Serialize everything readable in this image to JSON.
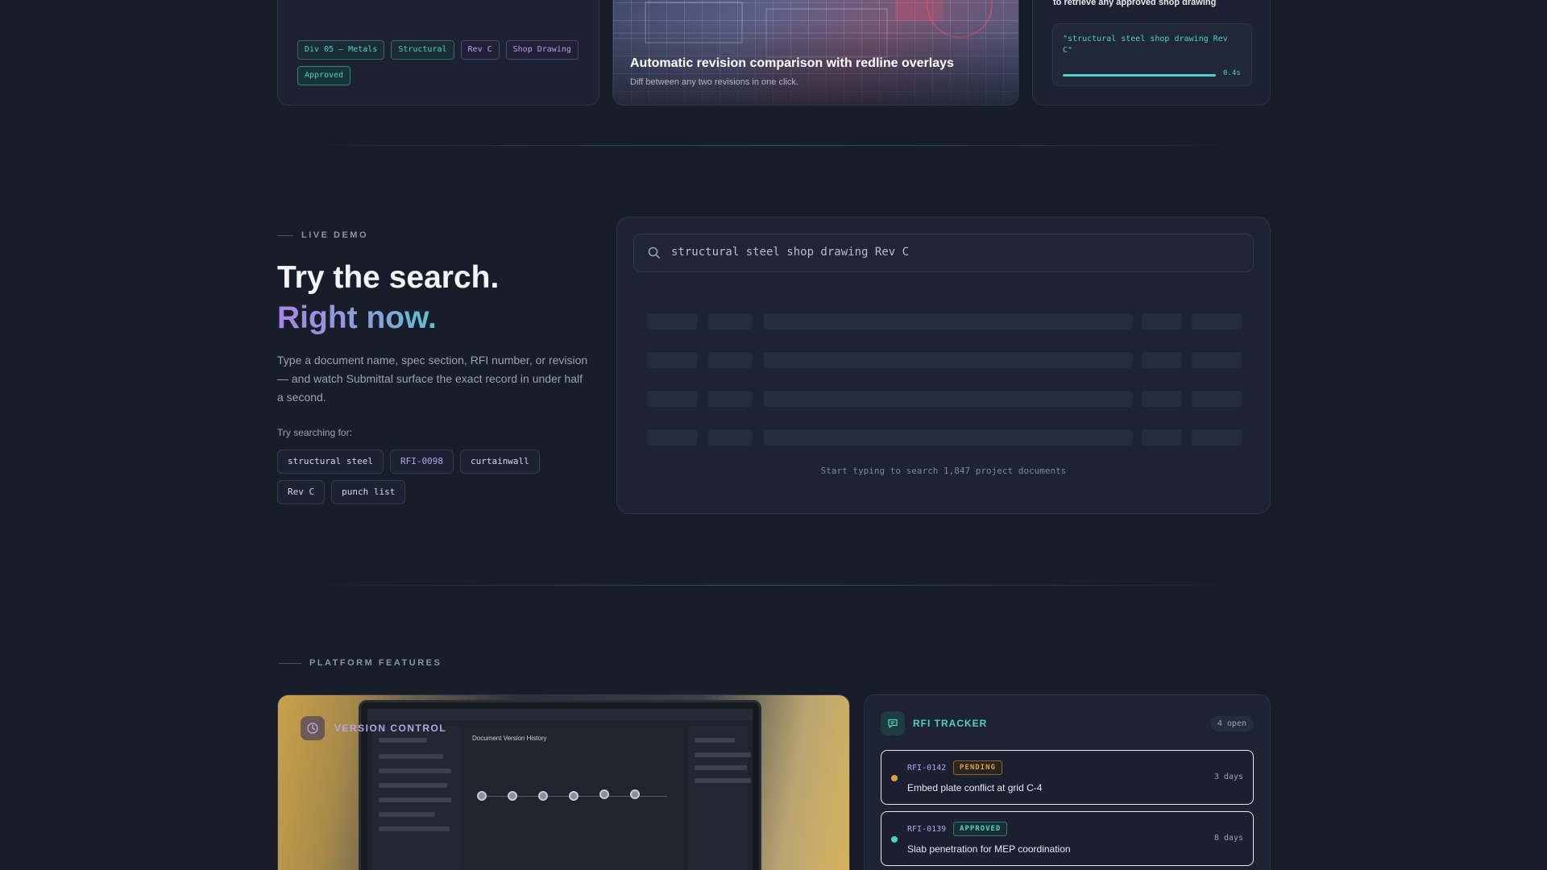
{
  "top_cards": {
    "tags": [
      {
        "label": "Div 05 — Metals",
        "style": "teal"
      },
      {
        "label": "Structural",
        "style": "teal"
      },
      {
        "label": "Rev C",
        "style": "purple"
      },
      {
        "label": "Shop Drawing",
        "style": "purple"
      },
      {
        "label": "Approved",
        "style": "green"
      }
    ],
    "revision": {
      "title": "Automatic revision comparison with redline overlays",
      "subtitle": "Diff between any two revisions in one click."
    },
    "query": {
      "heading": "to retrieve any approved shop drawing",
      "text": "\"structural steel shop drawing Rev C\"",
      "time": "0.4s",
      "progress": 1.0
    }
  },
  "live_demo": {
    "eyebrow": "LIVE DEMO",
    "headline_line1": "Try the search.",
    "headline_line2": "Right now.",
    "lead": "Type a document name, spec section, RFI number, or revision — and watch Submittal surface the exact record in under half a second.",
    "try_label": "Try searching for:",
    "suggestions": [
      "structural steel",
      "RFI-0098",
      "curtainwall",
      "Rev C",
      "punch list"
    ],
    "search_value": "structural steel shop drawing Rev C",
    "hint": "Start typing to search 1,847 project documents"
  },
  "platform_features": {
    "eyebrow": "PLATFORM FEATURES",
    "version_control": {
      "label": "VERSION CONTROL",
      "screen_title": "Document Version History"
    },
    "rfi_tracker": {
      "title": "RFI TRACKER",
      "count": "4 open",
      "items": [
        {
          "id": "RFI-0142",
          "status": "PENDING",
          "status_style": "pending",
          "desc": "Embed plate conflict at grid C-4",
          "age": "3 days"
        },
        {
          "id": "RFI-0139",
          "status": "APPROVED",
          "status_style": "approved",
          "desc": "Slab penetration for MEP coordination",
          "age": "8 days"
        }
      ]
    }
  },
  "colors": {
    "background": "#181d2a",
    "accent_teal": "#4fd1c5",
    "accent_purple": "#b7a4ec",
    "pending": "#e0a04a"
  }
}
